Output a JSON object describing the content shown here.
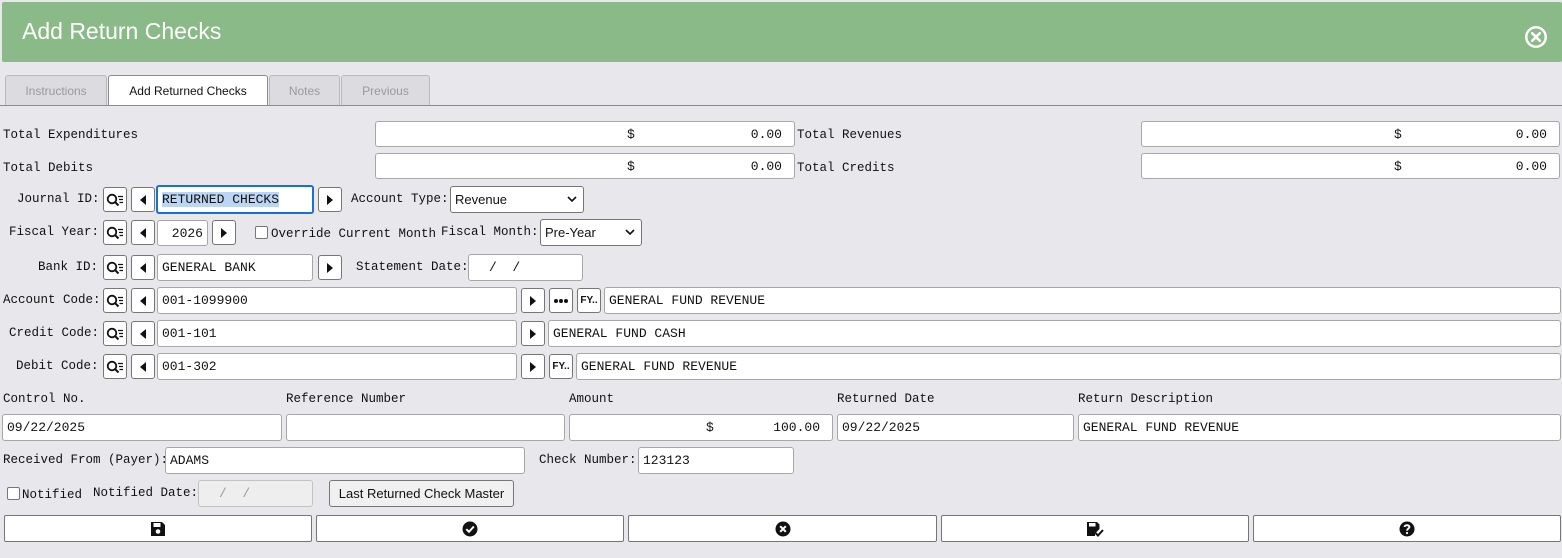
{
  "window": {
    "title": "Add Return Checks"
  },
  "tabs": [
    {
      "label": "Instructions",
      "active": false
    },
    {
      "label": "Add Returned Checks",
      "active": true
    },
    {
      "label": "Notes",
      "active": false
    },
    {
      "label": "Previous",
      "active": false
    }
  ],
  "totals": {
    "expenditures_label": "Total Expenditures",
    "expenditures_currency": "$",
    "expenditures_value": "0.00",
    "revenues_label": "Total Revenues",
    "revenues_currency": "$",
    "revenues_value": "0.00",
    "debits_label": "Total Debits",
    "debits_currency": "$",
    "debits_value": "0.00",
    "credits_label": "Total Credits",
    "credits_currency": "$",
    "credits_value": "0.00"
  },
  "journal": {
    "label": "Journal ID:",
    "value": "RETURNED CHECKS",
    "account_type_label": "Account Type:",
    "account_type_value": "Revenue"
  },
  "fiscal": {
    "year_label": "Fiscal Year:",
    "year_value": "2026",
    "override_label": "Override Current Month",
    "override_checked": false,
    "month_label": "Fiscal Month:",
    "month_value": "Pre-Year"
  },
  "bank": {
    "label": "Bank ID:",
    "value": "GENERAL BANK",
    "statement_label": "Statement Date:",
    "statement_value": "/  /"
  },
  "account_code": {
    "label": "Account Code:",
    "value": "001-1099900",
    "description": "GENERAL FUND REVENUE",
    "fy_text": "FY.."
  },
  "credit_code": {
    "label": "Credit Code:",
    "value": "001-101",
    "description": "GENERAL FUND CASH"
  },
  "debit_code": {
    "label": "Debit Code:",
    "value": "001-302",
    "description": "GENERAL FUND REVENUE",
    "fy_text": "FY.."
  },
  "details": {
    "control_label": "Control No.",
    "control_value": "09/22/2025",
    "reference_label": "Reference Number",
    "reference_value": "",
    "amount_label": "Amount",
    "amount_currency": "$",
    "amount_value": "100.00",
    "returned_date_label": "Returned Date",
    "returned_date_value": "09/22/2025",
    "return_desc_label": "Return Description",
    "return_desc_value": "GENERAL FUND REVENUE"
  },
  "payer": {
    "received_label": "Received From (Payer):",
    "received_value": "ADAMS",
    "check_number_label": "Check Number:",
    "check_number_value": "123123"
  },
  "notified": {
    "checkbox_label": "Notified",
    "checked": false,
    "date_label": "Notified Date:",
    "date_value": "/  /",
    "last_button_label": "Last Returned Check Master"
  },
  "bottom_bar": {
    "icons": [
      "save-icon",
      "check-circle-icon",
      "cancel-circle-icon",
      "save-check-icon",
      "help-icon"
    ]
  },
  "colors": {
    "header": "#8aba87",
    "background": "#e8e7ec",
    "focus": "#1a6fd6"
  }
}
